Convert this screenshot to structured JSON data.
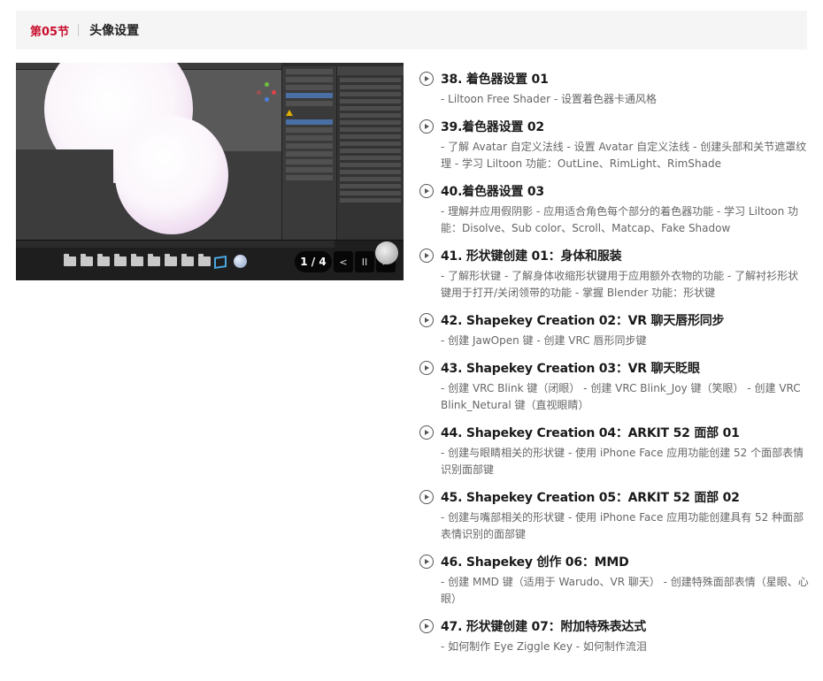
{
  "section": {
    "number": "第05节",
    "title": "头像设置"
  },
  "player": {
    "page_indicator": "1 / 4",
    "prev_label": "<",
    "pause_label": "II",
    "next_label": ">"
  },
  "lessons": [
    {
      "title": "38. 着色器设置 01",
      "desc": "- Liltoon Free Shader - 设置着色器卡通风格"
    },
    {
      "title": "39.着色器设置 02",
      "desc": "- 了解 Avatar 自定义法线 - 设置 Avatar 自定义法线 - 创建头部和关节遮罩纹理 - 学习 Liltoon 功能：OutLine、RimLight、RimShade"
    },
    {
      "title": "40.着色器设置 03",
      "desc": "- 理解并应用假阴影 - 应用适合角色每个部分的着色器功能 - 学习 Liltoon 功能：Disolve、Sub color、Scroll、Matcap、Fake Shadow"
    },
    {
      "title": "41. 形状键创建 01：身体和服装",
      "desc": "- 了解形状键 - 了解身体收缩形状键用于应用额外衣物的功能 - 了解衬衫形状键用于打开/关闭领带的功能 - 掌握 Blender 功能：形状键"
    },
    {
      "title": "42. Shapekey Creation 02：VR 聊天唇形同步",
      "desc": "- 创建 JawOpen 键 - 创建 VRC 唇形同步键"
    },
    {
      "title": "43. Shapekey Creation 03：VR 聊天眨眼",
      "desc": "- 创建 VRC Blink 键（闭眼） - 创建 VRC Blink_Joy 键（笑眼） - 创建 VRC Blink_Netural 键（直视眼睛）"
    },
    {
      "title": "44. Shapekey Creation 04：ARKIT 52 面部 01",
      "desc": "- 创建与眼睛相关的形状键 - 使用 iPhone Face 应用功能创建 52 个面部表情识别面部键"
    },
    {
      "title": "45. Shapekey Creation 05：ARKIT 52 面部 02",
      "desc": "- 创建与嘴部相关的形状键 - 使用 iPhone Face 应用功能创建具有 52 种面部表情识别的面部键"
    },
    {
      "title": "46. Shapekey 创作 06：MMD",
      "desc": "- 创建 MMD 键（适用于 Warudo、VR 聊天） - 创建特殊面部表情（星眼、心眼）"
    },
    {
      "title": "47. 形状键创建 07：附加特殊表达式",
      "desc": "- 如何制作 Eye Ziggle Key - 如何制作流泪"
    }
  ],
  "colors": {
    "section_number": "#c8102e",
    "header_bg": "#f5f5f5",
    "text_primary": "#1a1a1a",
    "text_secondary": "#666666"
  }
}
